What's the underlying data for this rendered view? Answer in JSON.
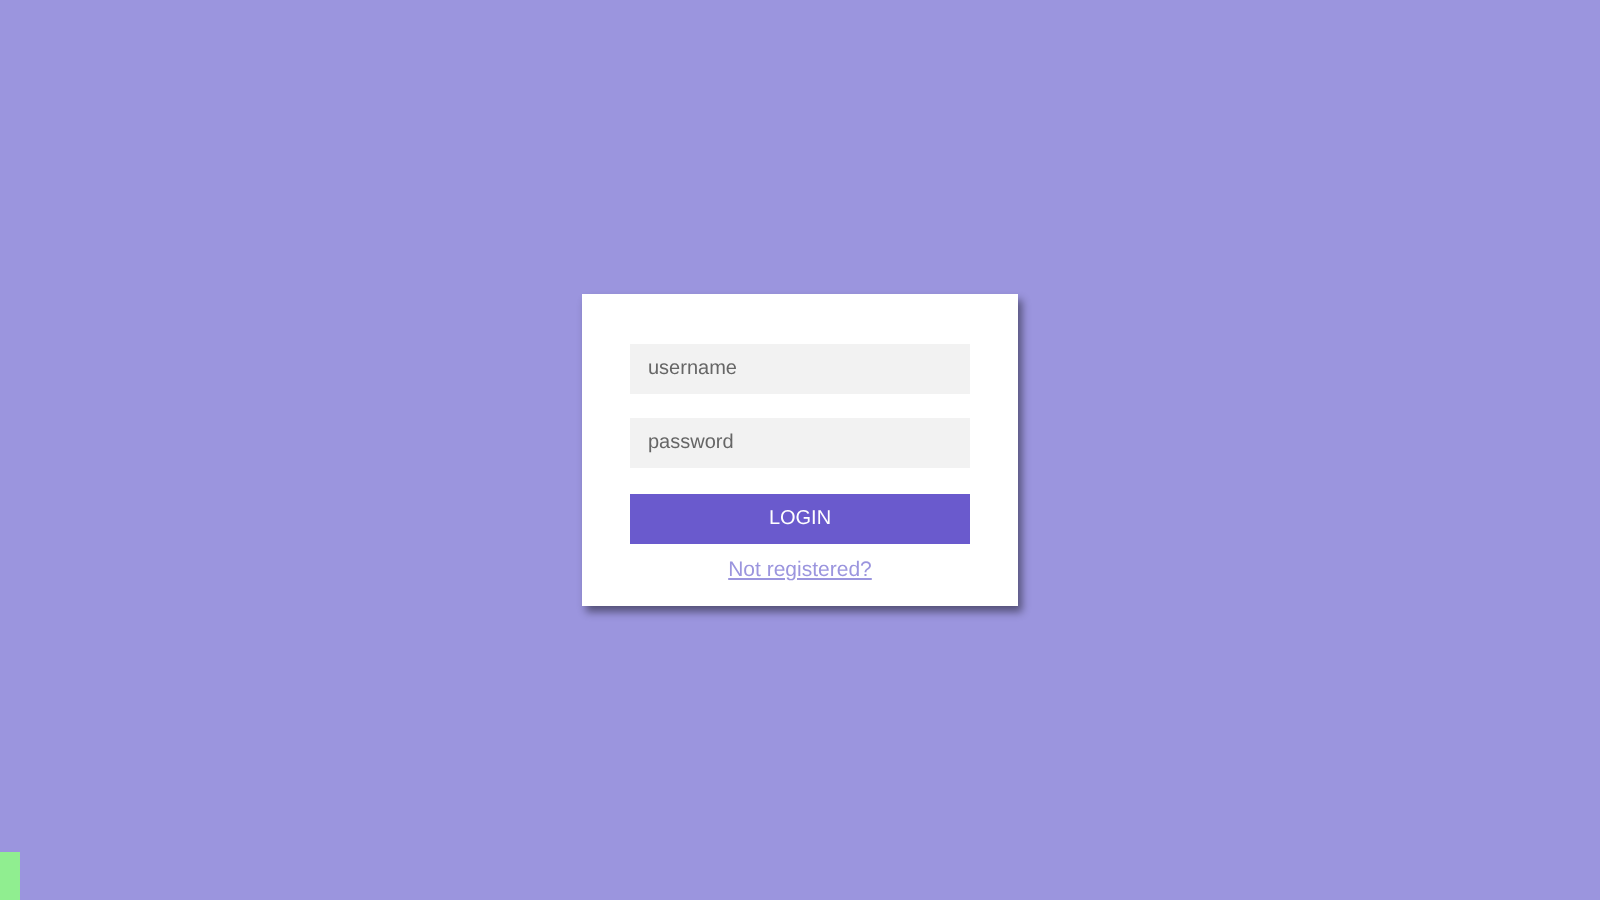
{
  "login_form": {
    "username": {
      "placeholder": "username"
    },
    "password": {
      "placeholder": "password"
    },
    "login_button": "LOGIN",
    "register_link": "Not registered?"
  }
}
